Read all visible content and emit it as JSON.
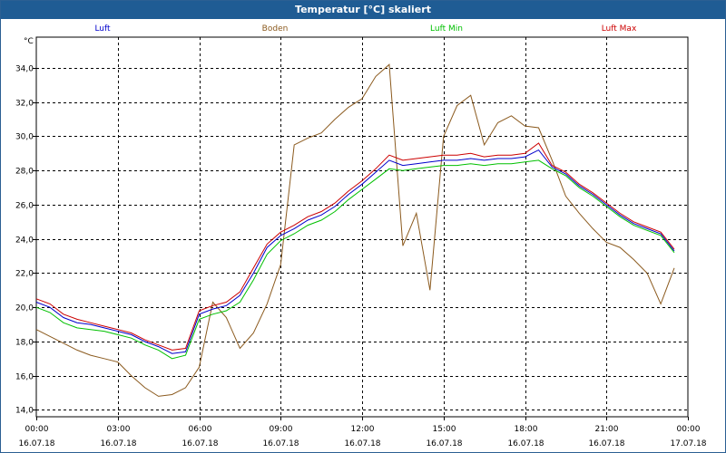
{
  "window": {
    "title": "Temperatur [°C] skaliert"
  },
  "chart_data": {
    "type": "line",
    "title": "Temperatur [°C] skaliert",
    "ylabel": "°C",
    "ylim": [
      13.6,
      35.8
    ],
    "xlim": [
      0,
      24
    ],
    "grid": true,
    "yticks": [
      "14,0",
      "16,0",
      "18,0",
      "20,0",
      "22,0",
      "24,0",
      "26,0",
      "28,0",
      "30,0",
      "32,0",
      "34,0"
    ],
    "xticks": [
      {
        "time": "00:00",
        "date": "16.07.18"
      },
      {
        "time": "03:00",
        "date": "16.07.18"
      },
      {
        "time": "06:00",
        "date": "16.07.18"
      },
      {
        "time": "09:00",
        "date": "16.07.18"
      },
      {
        "time": "12:00",
        "date": "16.07.18"
      },
      {
        "time": "15:00",
        "date": "16.07.18"
      },
      {
        "time": "18:00",
        "date": "16.07.18"
      },
      {
        "time": "21:00",
        "date": "16.07.18"
      },
      {
        "time": "00:00",
        "date": "17.07.18"
      }
    ],
    "x": [
      0,
      0.5,
      1,
      1.5,
      2,
      2.5,
      3,
      3.5,
      4,
      4.5,
      5,
      5.5,
      6,
      6.5,
      7,
      7.5,
      8,
      8.5,
      9,
      9.5,
      10,
      10.5,
      11,
      11.5,
      12,
      12.5,
      13,
      13.5,
      14,
      14.5,
      15,
      15.5,
      16,
      16.5,
      17,
      17.5,
      18,
      18.5,
      19,
      19.5,
      20,
      20.5,
      21,
      21.5,
      22,
      22.5,
      23,
      23.5
    ],
    "series": [
      {
        "name": "Luft",
        "color": "#0000cc",
        "values": [
          20.3,
          20.0,
          19.4,
          19.1,
          19.0,
          18.8,
          18.6,
          18.4,
          18.0,
          17.7,
          17.3,
          17.4,
          19.6,
          19.9,
          20.1,
          20.7,
          22.0,
          23.5,
          24.2,
          24.6,
          25.1,
          25.4,
          25.9,
          26.6,
          27.2,
          27.9,
          28.6,
          28.3,
          28.4,
          28.5,
          28.6,
          28.6,
          28.7,
          28.6,
          28.7,
          28.7,
          28.8,
          29.2,
          28.2,
          27.8,
          27.1,
          26.6,
          26.0,
          25.4,
          24.9,
          24.6,
          24.3,
          23.3
        ]
      },
      {
        "name": "Boden",
        "color": "#8b5a1e",
        "values": [
          18.7,
          18.3,
          17.9,
          17.5,
          17.2,
          17.0,
          16.8,
          16.0,
          15.3,
          14.8,
          14.9,
          15.3,
          16.5,
          20.3,
          19.4,
          17.6,
          18.5,
          20.2,
          22.5,
          29.5,
          29.9,
          30.2,
          31.0,
          31.7,
          32.2,
          33.5,
          34.2,
          23.6,
          25.5,
          21.0,
          30.0,
          31.8,
          32.4,
          29.5,
          30.8,
          31.2,
          30.6,
          30.5,
          28.6,
          26.5,
          25.5,
          24.6,
          23.8,
          23.5,
          22.8,
          22.0,
          20.2,
          22.3
        ]
      },
      {
        "name": "Luft Min",
        "color": "#00c000",
        "values": [
          20.0,
          19.7,
          19.1,
          18.8,
          18.7,
          18.6,
          18.4,
          18.2,
          17.8,
          17.5,
          17.0,
          17.2,
          19.3,
          19.6,
          19.8,
          20.3,
          21.6,
          23.1,
          23.9,
          24.3,
          24.8,
          25.1,
          25.6,
          26.3,
          26.9,
          27.5,
          28.1,
          28.0,
          28.1,
          28.2,
          28.3,
          28.3,
          28.4,
          28.3,
          28.4,
          28.4,
          28.5,
          28.6,
          28.1,
          27.7,
          27.0,
          26.5,
          25.9,
          25.3,
          24.8,
          24.5,
          24.2,
          23.2
        ]
      },
      {
        "name": "Luft Max",
        "color": "#cc0000",
        "values": [
          20.5,
          20.2,
          19.6,
          19.3,
          19.1,
          18.9,
          18.7,
          18.5,
          18.1,
          17.8,
          17.5,
          17.6,
          19.8,
          20.1,
          20.3,
          20.9,
          22.3,
          23.7,
          24.4,
          24.8,
          25.3,
          25.6,
          26.1,
          26.8,
          27.4,
          28.1,
          28.9,
          28.6,
          28.7,
          28.8,
          28.9,
          28.9,
          29.0,
          28.8,
          28.9,
          28.9,
          29.0,
          29.6,
          28.3,
          27.9,
          27.2,
          26.7,
          26.1,
          25.5,
          25.0,
          24.7,
          24.4,
          23.4
        ]
      }
    ]
  }
}
